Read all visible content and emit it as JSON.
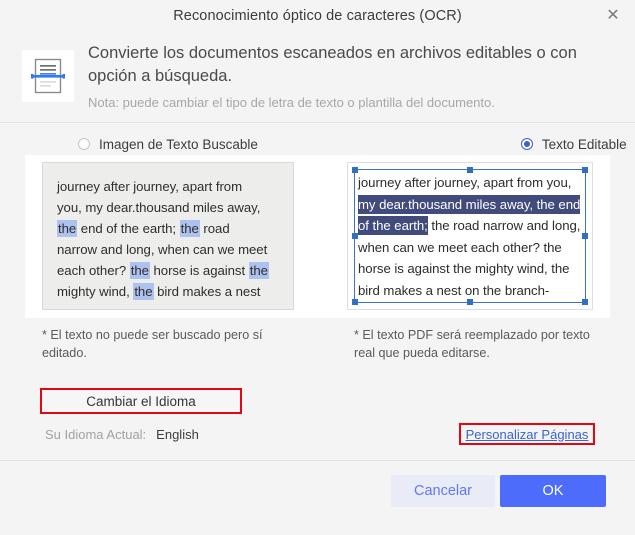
{
  "window": {
    "title": "Reconocimiento óptico de caracteres (OCR)",
    "close_label": "✕"
  },
  "header": {
    "icon": "scanned-document-icon",
    "main_text": "Convierte los documentos escaneados en archivos editables o con opción a búsqueda.",
    "note_text": "Nota: puede cambiar el tipo de letra de texto o plantilla del documento."
  },
  "mode_options": {
    "searchable": {
      "label": "Imagen de Texto Buscable",
      "selected": false
    },
    "editable": {
      "label": "Texto Editable",
      "selected": true
    }
  },
  "preview_left": {
    "line1": "journey after journey, apart from",
    "line2": "you, my dear.thousand miles away,",
    "line3_hl": "the",
    "line3_mid": " end of the earth; ",
    "line3_hl2": "the",
    "line3_end": " road",
    "line4": "narrow and long, when can we meet",
    "line5_start": "each other? ",
    "line5_hl": "the",
    "line5_mid": " horse is against ",
    "line5_hl2": "the",
    "line6_start": "mighty wind, ",
    "line6_hl": "the",
    "line6_end": " bird makes a nest",
    "highlight_color": "#aec2ef"
  },
  "preview_right": {
    "part1": "journey after journey, apart from you, ",
    "selected": "my dear.thousand miles away, the end of the earth;",
    "part2": " the road narrow and long, when can we meet each other? the horse is against the mighty wind, the bird makes a nest on the branch-",
    "selection_color": "#414b7c"
  },
  "captions": {
    "left": "* El texto no puede ser buscado pero sí editado.",
    "right": "* El texto PDF será reemplazado por texto real que pueda editarse."
  },
  "language": {
    "change_button": "Cambiar el Idioma",
    "current_label": "Su Idioma Actual:",
    "current_value": "English"
  },
  "custom_pages": {
    "link_label": "Personalizar Páginas"
  },
  "footer": {
    "cancel_label": "Cancelar",
    "ok_label": "OK",
    "ok_color": "#4d6cfb",
    "cancel_color": "#e9ecf7"
  },
  "highlight_boxes_color": "#e30613"
}
